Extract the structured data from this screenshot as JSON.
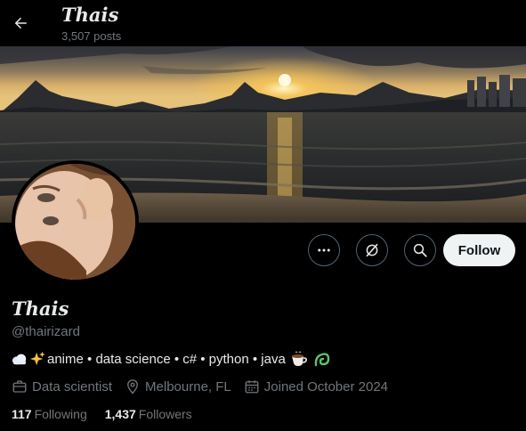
{
  "header": {
    "name": "Thais",
    "post_count": "3,507 posts"
  },
  "banner": {
    "icon": "sunset-beach-photo"
  },
  "profile": {
    "display_name": "Thais",
    "handle": "@thairizard",
    "bio_text": "anime • data science • c# • python • java",
    "bio_emoji": [
      "cloud",
      "sparkles",
      "coffee",
      "green-plant"
    ],
    "profession": "Data scientist",
    "location": "Melbourne, FL",
    "joined": "Joined October 2024"
  },
  "actions": {
    "more_icon": "more-icon",
    "grok_icon": "grok-icon",
    "search_icon": "search-icon",
    "follow_label": "Follow"
  },
  "stats": {
    "following_count": "117",
    "following_label": "Following",
    "followers_count": "1,437",
    "followers_label": "Followers"
  },
  "colors": {
    "background": "#000000",
    "text_primary": "#e7e9ea",
    "text_secondary": "#71767b",
    "button_border": "#536471",
    "follow_bg": "#eff3f4"
  }
}
